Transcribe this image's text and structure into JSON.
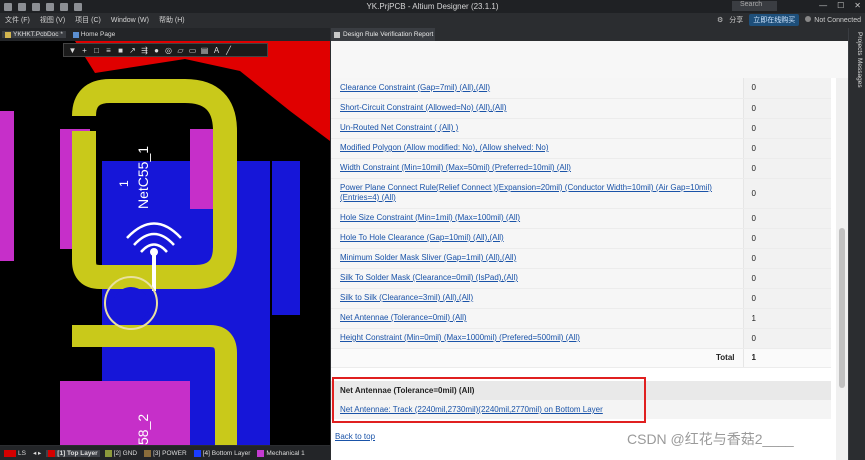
{
  "window": {
    "title": "YK.PrjPCB - Altium Designer (23.1.1)",
    "search_label": "Search",
    "connection_status": "Not Connected",
    "share_label": "分享",
    "online_label": "立即在线购买"
  },
  "menu": [
    "文件 (F)",
    "视图 (V)",
    "项目 (C)",
    "Window (W)",
    "帮助 (H)"
  ],
  "left_tabs": [
    {
      "label": "YKHKT.PcbDoc *"
    },
    {
      "label": "Home Page"
    }
  ],
  "report_tab": {
    "label": "Design Rule Verification Report"
  },
  "pcb": {
    "net_label": "NetC55_1",
    "pin_label": "1",
    "lower_label": "58_2"
  },
  "layers": [
    {
      "label": "LS",
      "color": "#d40000"
    },
    {
      "label": "[1] Top Layer",
      "color": "#d40000",
      "active": true
    },
    {
      "label": "[2] GND",
      "color": "#8c9a3c"
    },
    {
      "label": "[3] POWER",
      "color": "#8a6d3b"
    },
    {
      "label": "[4] Bottom Layer",
      "color": "#1a3cff"
    },
    {
      "label": "Mechanical 1",
      "color": "#c43bd1"
    }
  ],
  "rules": [
    {
      "name": "Clearance Constraint (Gap=7mil) (All),(All)",
      "count": "0"
    },
    {
      "name": "Short-Circuit Constraint (Allowed=No) (All),(All)",
      "count": "0"
    },
    {
      "name": "Un-Routed Net Constraint ( (All) )",
      "count": "0"
    },
    {
      "name": "Modified Polygon (Allow modified: No), (Allow shelved: No)",
      "count": "0"
    },
    {
      "name": "Width Constraint (Min=10mil) (Max=50mil) (Preferred=10mil) (All)",
      "count": "0"
    },
    {
      "name": "Power Plane Connect Rule(Relief Connect )(Expansion=20mil) (Conductor Width=10mil) (Air Gap=10mil) (Entries=4) (All)",
      "count": "0",
      "tall": true
    },
    {
      "name": "Hole Size Constraint (Min=1mil) (Max=100mil) (All)",
      "count": "0"
    },
    {
      "name": "Hole To Hole Clearance (Gap=10mil) (All),(All)",
      "count": "0"
    },
    {
      "name": "Minimum Solder Mask Sliver (Gap=1mil) (All),(All)",
      "count": "0"
    },
    {
      "name": "Silk To Solder Mask (Clearance=0mil) (IsPad),(All)",
      "count": "0"
    },
    {
      "name": "Silk to Silk (Clearance=3mil) (All),(All)",
      "count": "0"
    },
    {
      "name": "Net Antennae (Tolerance=0mil) (All)",
      "count": "1"
    },
    {
      "name": "Height Constraint (Min=0mil) (Max=1000mil) (Prefered=500mil) (All)",
      "count": "0"
    }
  ],
  "total": {
    "label": "Total",
    "value": "1"
  },
  "detail": {
    "heading": "Net Antennae (Tolerance=0mil) (All)",
    "item": "Net Antennae: Track (2240mil,2730mil)(2240mil,2770mil) on Bottom Layer"
  },
  "back_to_top": "Back to top",
  "watermark": "CSDN @红花与香菇2____",
  "side_panels": [
    "Projects",
    "Messages"
  ]
}
